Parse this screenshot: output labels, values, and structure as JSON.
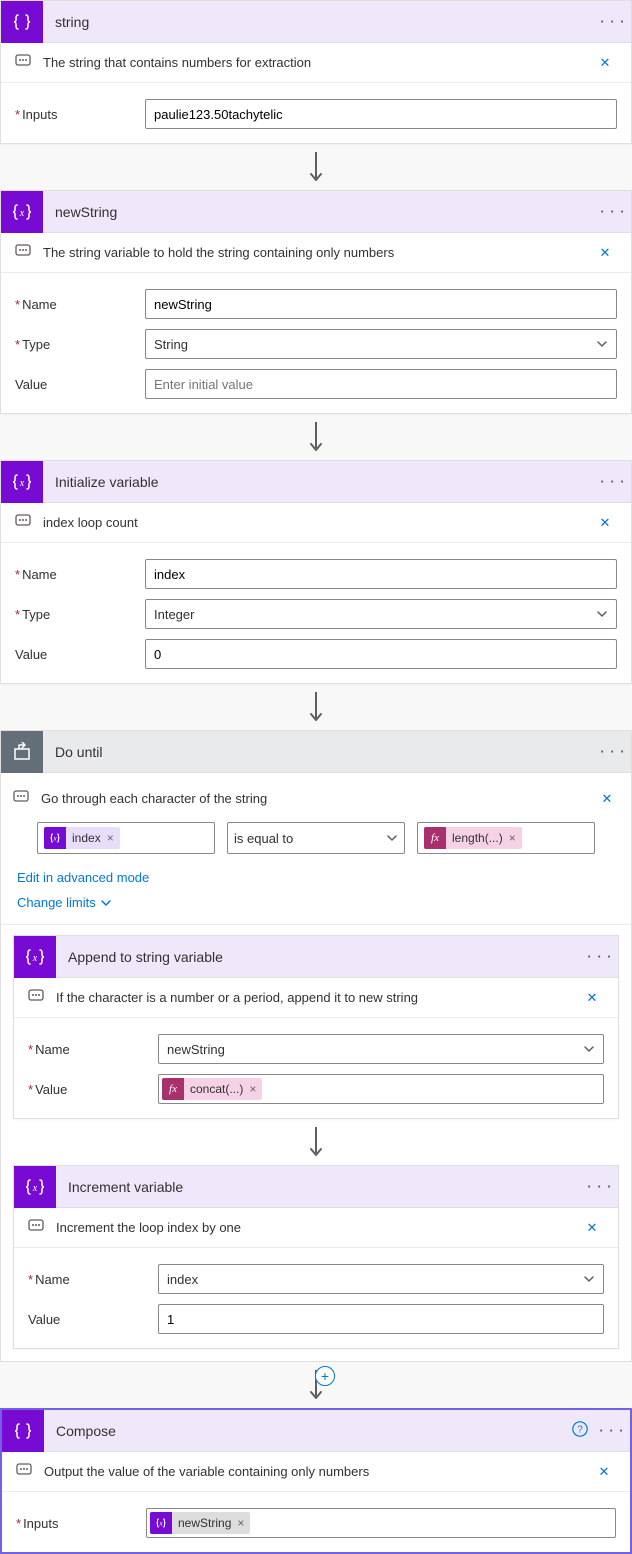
{
  "step1": {
    "title": "string",
    "comment": "The string that contains numbers for extraction",
    "inputs_label": "Inputs",
    "inputs_value": "paulie123.50tachytelic"
  },
  "step2": {
    "title": "newString",
    "comment": "The string variable to hold the string containing only numbers",
    "name_label": "Name",
    "name_value": "newString",
    "type_label": "Type",
    "type_value": "String",
    "value_label": "Value",
    "value_placeholder": "Enter initial value"
  },
  "step3": {
    "title": "Initialize variable",
    "comment": "index loop count",
    "name_label": "Name",
    "name_value": "index",
    "type_label": "Type",
    "type_value": "Integer",
    "value_label": "Value",
    "value_value": "0"
  },
  "loop": {
    "title": "Do until",
    "comment": "Go through each character of the string",
    "left_token": "index",
    "operator": "is equal to",
    "right_token": "length(...)",
    "advanced_link": "Edit in advanced mode",
    "limits_link": "Change limits"
  },
  "append": {
    "title": "Append to string variable",
    "comment": "If the character is a number or a period, append it to new string",
    "name_label": "Name",
    "name_value": "newString",
    "value_label": "Value",
    "value_token": "concat(...)"
  },
  "increment": {
    "title": "Increment variable",
    "comment": "Increment the loop index by one",
    "name_label": "Name",
    "name_value": "index",
    "value_label": "Value",
    "value_value": "1"
  },
  "compose": {
    "title": "Compose",
    "comment": "Output the value of the variable containing only numbers",
    "inputs_label": "Inputs",
    "inputs_token": "newString"
  },
  "glyphs": {
    "menu": "· · ·",
    "close": "✕",
    "times": "×",
    "help": "?",
    "plus": "+"
  }
}
